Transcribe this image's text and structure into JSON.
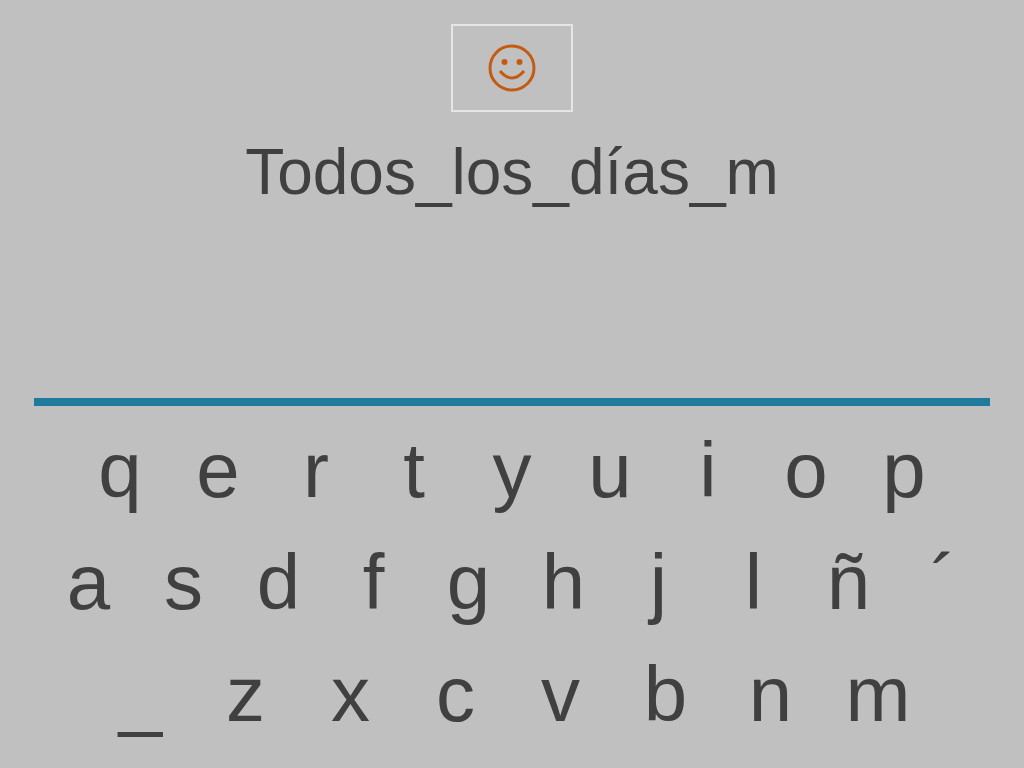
{
  "answer": "Todos_los_días_m",
  "keyboard": {
    "rows": [
      [
        "q",
        "e",
        "r",
        "t",
        "y",
        "u",
        "i",
        "o",
        "p"
      ],
      [
        "a",
        "s",
        "d",
        "f",
        "g",
        "h",
        "j",
        "l",
        "ñ",
        "´"
      ],
      [
        "_",
        "z",
        "x",
        "c",
        "v",
        "b",
        "n",
        "m"
      ]
    ]
  }
}
